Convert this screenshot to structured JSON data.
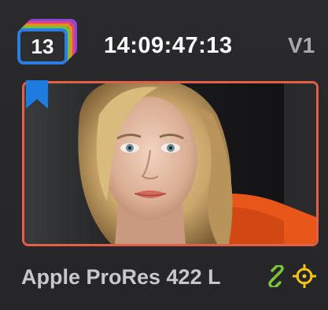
{
  "clip": {
    "number": "13",
    "timecode": "14:09:47:13",
    "track": "V1",
    "codec": "Apple ProRes 422 L"
  },
  "icons": {
    "flag": "bookmark-flag-icon",
    "link": "link-icon",
    "target": "crosshair-target-icon"
  },
  "colors": {
    "flag": "#1e7be0",
    "thumbnail_border": "#e0604a",
    "link": "#7cc43a",
    "target": "#f2c21a",
    "badge_layers": [
      "#8b45d8",
      "#e0457a",
      "#f08a1a",
      "#6cc24a",
      "#2a7de1"
    ]
  }
}
